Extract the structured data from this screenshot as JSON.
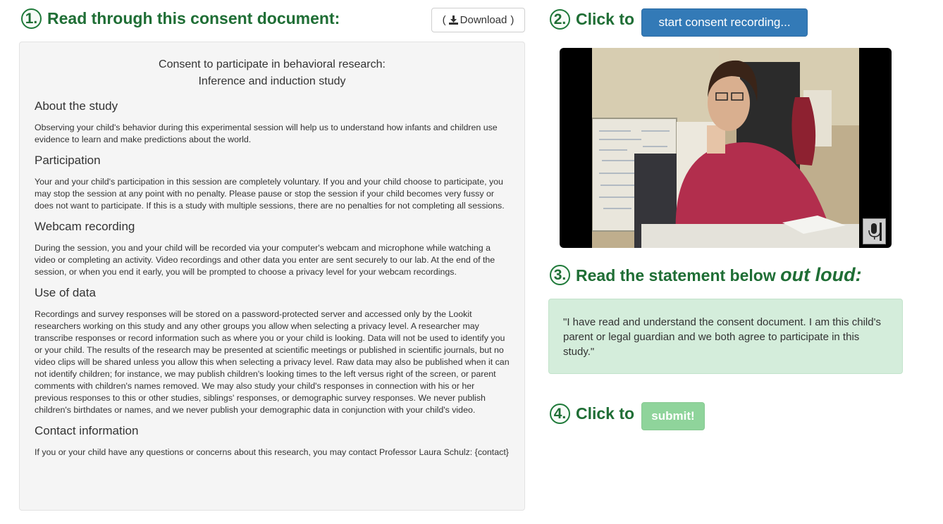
{
  "step1": {
    "number": "1.",
    "label": "Read through this consent document:"
  },
  "download": {
    "open_paren": "(",
    "label": "Download",
    "close_paren": ")",
    "icon": "download-icon"
  },
  "consent": {
    "title_line1": "Consent to participate in behavioral research:",
    "title_line2": "Inference and induction study",
    "sections": [
      {
        "heading": "About the study",
        "body": "Observing your child's behavior during this experimental session will help us to understand how infants and children use evidence to learn and make predictions about the world."
      },
      {
        "heading": "Participation",
        "body": "Your and your child's participation in this session are completely voluntary. If you and your child choose to participate, you may stop the session at any point with no penalty. Please pause or stop the session if your child becomes very fussy or does not want to participate. If this is a study with multiple sessions, there are no penalties for not completing all sessions."
      },
      {
        "heading": "Webcam recording",
        "body": "During the session, you and your child will be recorded via your computer's webcam and microphone while watching a video or completing an activity. Video recordings and other data you enter are sent securely to our lab. At the end of the session, or when you end it early, you will be prompted to choose a privacy level for your webcam recordings."
      },
      {
        "heading": "Use of data",
        "body": "Recordings and survey responses will be stored on a password-protected server and accessed only by the Lookit researchers working on this study and any other groups you allow when selecting a privacy level. A researcher may transcribe responses or record information such as where you or your child is looking. Data will not be used to identify you or your child. The results of the research may be presented at scientific meetings or published in scientific journals, but no video clips will be shared unless you allow this when selecting a privacy level. Raw data may also be published when it can not identify children; for instance, we may publish children's looking times to the left versus right of the screen, or parent comments with children's names removed. We may also study your child's responses in connection with his or her previous responses to this or other studies, siblings' responses, or demographic survey responses. We never publish children's birthdates or names, and we never publish your demographic data in conjunction with your child's video."
      },
      {
        "heading": "Contact information",
        "body": "If you or your child have any questions or concerns about this research, you may contact Professor Laura Schulz: {contact}"
      }
    ]
  },
  "step2": {
    "number": "2.",
    "label": "Click to"
  },
  "record_button": {
    "label": "start consent recording..."
  },
  "video": {
    "mic_icon": "microphone-icon"
  },
  "step3": {
    "number": "3.",
    "label": "Read the statement below",
    "emphasis": "out loud:"
  },
  "statement": {
    "text": "\"I have read and understand the consent document. I am this child's parent or legal guardian and we both agree to participate in this study.\""
  },
  "step4": {
    "number": "4.",
    "label": "Click to"
  },
  "submit_button": {
    "label": "submit!"
  },
  "colors": {
    "step_green": "#1f6e35",
    "primary_blue": "#337ab7",
    "statement_bg": "#d4eddb",
    "submit_disabled": "#8fd49b"
  }
}
